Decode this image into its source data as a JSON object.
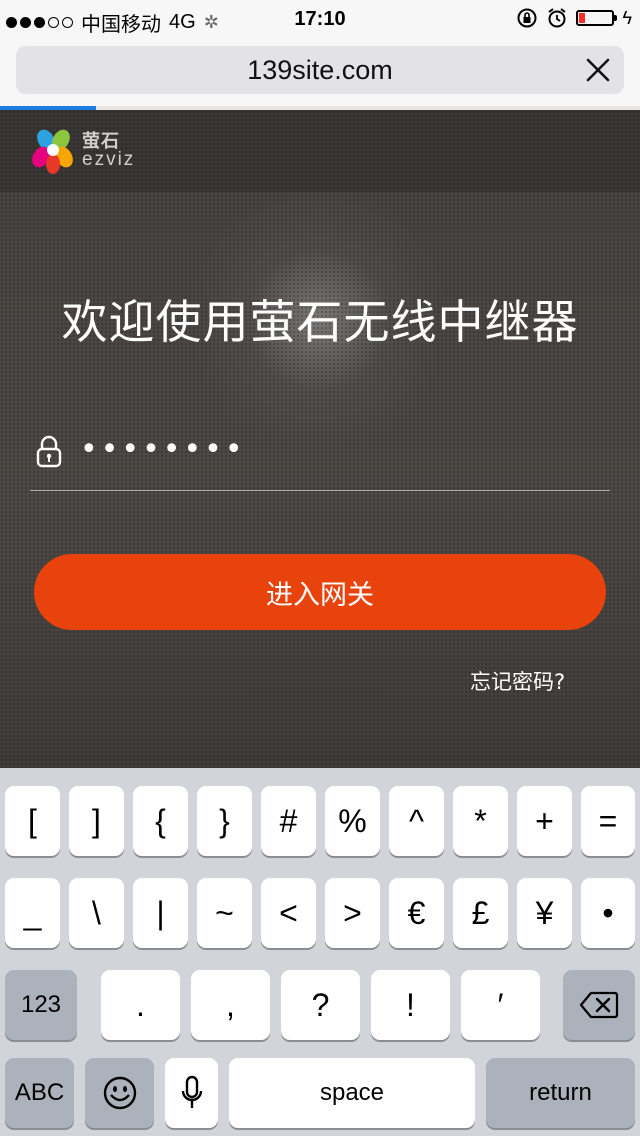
{
  "status_bar": {
    "carrier": "中国移动",
    "network": "4G",
    "time": "17:10",
    "battery_level": 0.18,
    "signal_bars_filled": 3,
    "signal_bars_total": 5
  },
  "browser": {
    "url": "139site.com",
    "close_icon": "close-icon",
    "load_progress": 0.15
  },
  "page": {
    "brand_cn": "萤石",
    "brand_en": "ezviz",
    "title": "欢迎使用萤石无线中继器",
    "password_value": "••••••••",
    "enter_button": "进入网关",
    "forgot_link": "忘记密码?",
    "accent_color": "#e8430d"
  },
  "keyboard": {
    "row1": [
      "[",
      "]",
      "{",
      "}",
      "#",
      "%",
      "^",
      "*",
      "+",
      "="
    ],
    "row2": [
      "_",
      "\\",
      "|",
      "~",
      "<",
      ">",
      "€",
      "£",
      "¥",
      "•"
    ],
    "row3": [
      ".",
      ",",
      "?",
      "!",
      "′"
    ],
    "mode_123": "123",
    "mode_abc": "ABC",
    "space": "space",
    "return": "return",
    "delete_icon": "backspace-icon",
    "emoji_icon": "emoji-icon",
    "mic_icon": "microphone-icon"
  }
}
